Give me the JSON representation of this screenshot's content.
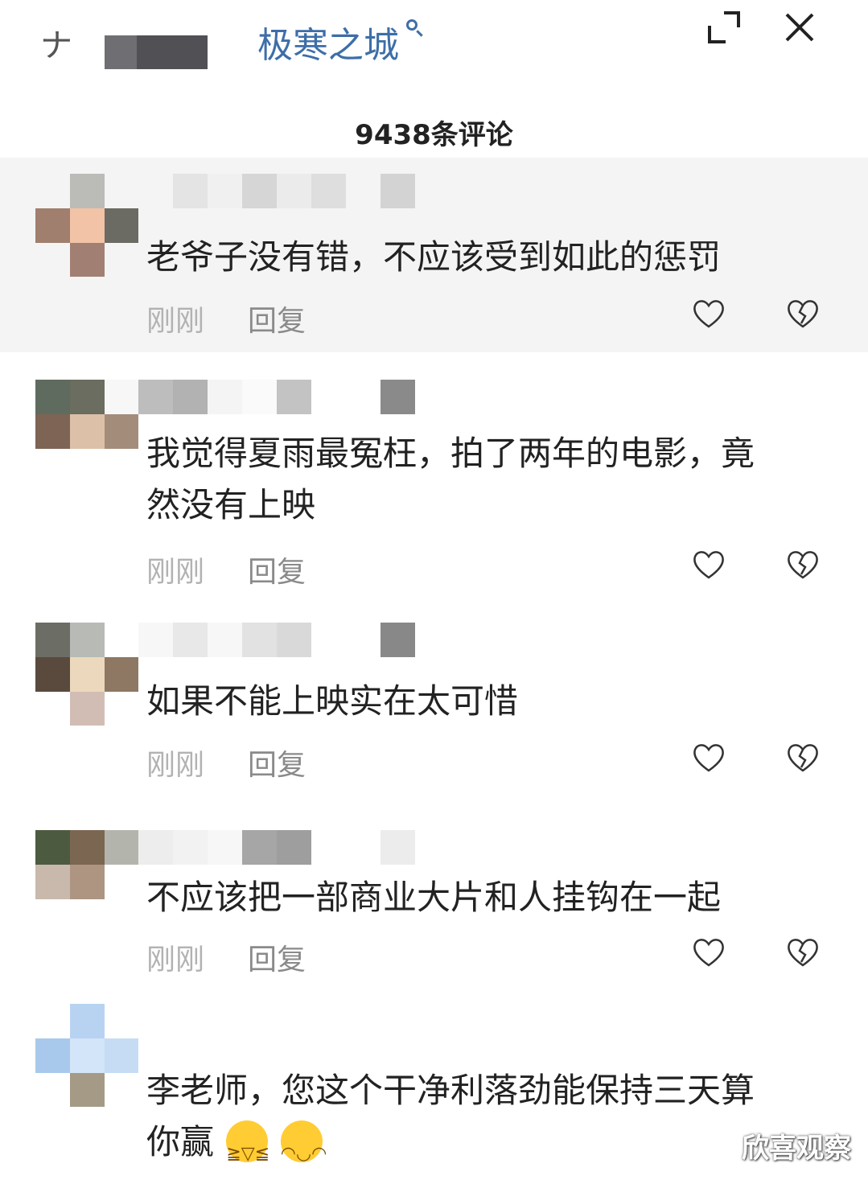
{
  "header": {
    "left_glyph": "ナ",
    "search_title": "极寒之城",
    "comment_count": "9438条评论"
  },
  "comments": [
    {
      "text_lines": [
        "老爷子没有错，不应该受到如此的惩罚"
      ],
      "time": "刚刚",
      "reply": "回复"
    },
    {
      "text_lines": [
        "我觉得夏雨最冤枉，拍了两年的电影，竟",
        "然没有上映"
      ],
      "time": "刚刚",
      "reply": "回复"
    },
    {
      "text_lines": [
        "如果不能上映实在太可惜"
      ],
      "time": "刚刚",
      "reply": "回复"
    },
    {
      "text_lines": [
        "不应该把一部商业大片和人挂钩在一起"
      ],
      "time": "刚刚",
      "reply": "回复"
    },
    {
      "text_lines": [
        "李老师，您这个干净利落劲能保持三天算",
        "你赢"
      ],
      "emojis": [
        "rolling-laughing-emoji",
        "grinning-emoji"
      ]
    }
  ],
  "watermark": "欣喜观察",
  "colors": {
    "accent": "#3d6ea8",
    "highlight_bg": "#f4f4f4",
    "meta_gray": "#b2b2b2"
  }
}
